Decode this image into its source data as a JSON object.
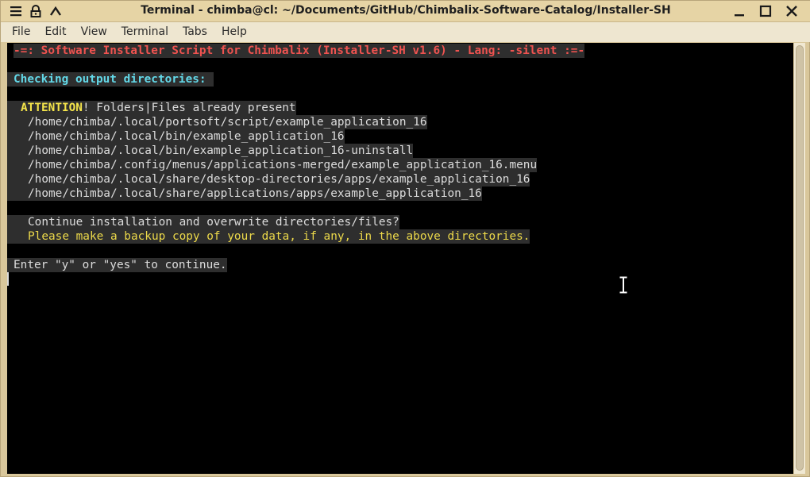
{
  "window": {
    "title": "Terminal - chimba@cl: ~/Documents/GitHub/Chimbalix-Software-Catalog/Installer-SH",
    "buttons": {
      "menu": "menu-icon",
      "pin": "pin-icon",
      "roll": "rollup-icon",
      "minimize": "minimize-icon",
      "maximize": "maximize-icon",
      "close": "close-icon"
    }
  },
  "menubar": {
    "items": [
      "File",
      "Edit",
      "View",
      "Terminal",
      "Tabs",
      "Help"
    ]
  },
  "terminal": {
    "header": "-=: Software Installer Script for Chimbalix (Installer-SH v1.6) - Lang: -silent :=-",
    "checking": "Checking output directories:",
    "attention_word": "ATTENTION",
    "attention_rest": "! Folders|Files already present",
    "paths": [
      "/home/chimba/.local/portsoft/script/example_application_16",
      "/home/chimba/.local/bin/example_application_16",
      "/home/chimba/.local/bin/example_application_16-uninstall",
      "/home/chimba/.config/menus/applications-merged/example_application_16.menu",
      "/home/chimba/.local/share/desktop-directories/apps/example_application_16",
      "/home/chimba/.local/share/applications/apps/example_application_16"
    ],
    "continue_question": "Continue installation and overwrite directories/files?",
    "backup_warning": "Please make a backup copy of your data, if any, in the above directories.",
    "enter_prompt": "Enter \"y\" or \"yes\" to continue."
  },
  "colors": {
    "header": "#ef5350",
    "checking": "#63d8e8",
    "attention": "#f4e44a",
    "warning": "#ecd94a",
    "terminal_bg": "#000000",
    "text": "#dcdcdc"
  }
}
